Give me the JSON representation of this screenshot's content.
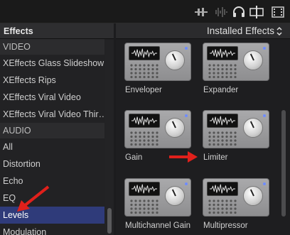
{
  "toolbar": {
    "icons": [
      "audio-meter-icon",
      "waveform-icon",
      "headphones-icon",
      "skimming-icon",
      "filmstrip-icon"
    ]
  },
  "sidebar": {
    "title": "Effects",
    "items": [
      {
        "label": "VIDEO",
        "type": "section"
      },
      {
        "label": "XEffects Glass Slideshow",
        "type": "item"
      },
      {
        "label": "XEffects Rips",
        "type": "item"
      },
      {
        "label": "XEffects Viral Video",
        "type": "item"
      },
      {
        "label": "XEffects Viral Video Thir…",
        "type": "item"
      },
      {
        "label": "AUDIO",
        "type": "section"
      },
      {
        "label": "All",
        "type": "item"
      },
      {
        "label": "Distortion",
        "type": "item"
      },
      {
        "label": "Echo",
        "type": "item"
      },
      {
        "label": "EQ",
        "type": "item"
      },
      {
        "label": "Levels",
        "type": "item",
        "selected": true
      },
      {
        "label": "Modulation",
        "type": "item"
      }
    ]
  },
  "browser": {
    "title": "Installed Effects",
    "effects": [
      {
        "name": "Enveloper"
      },
      {
        "name": "Expander"
      },
      {
        "name": "Gain"
      },
      {
        "name": "Limiter"
      },
      {
        "name": "Multichannel Gain"
      },
      {
        "name": "Multipressor"
      }
    ]
  },
  "colors": {
    "selection": "#2f3b7a",
    "annotation_arrow": "#e0201b",
    "led": "#6f8cff"
  }
}
